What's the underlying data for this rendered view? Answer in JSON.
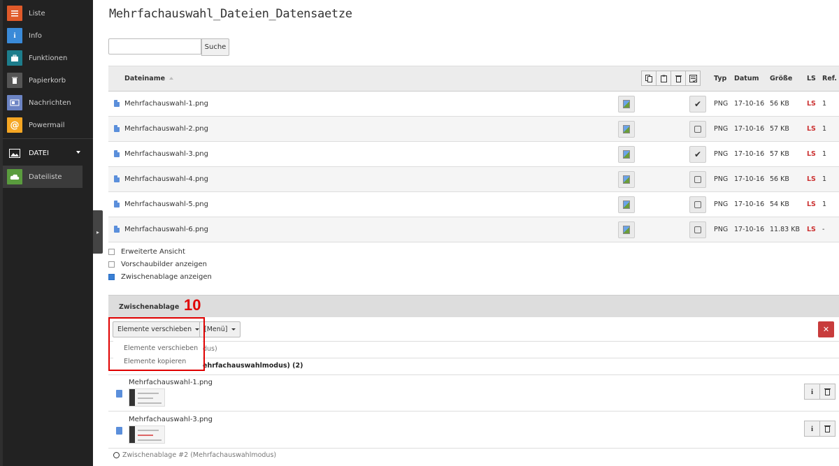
{
  "sidebar": {
    "modules": [
      {
        "label": "Liste",
        "icon": "list-icon",
        "color": "#e05a2a"
      },
      {
        "label": "Info",
        "icon": "info-icon",
        "color": "#3a8ad8"
      },
      {
        "label": "Funktionen",
        "icon": "toolbox-icon",
        "color": "#1d7d8c"
      },
      {
        "label": "Papierkorb",
        "icon": "trash-icon",
        "color": "#555555"
      },
      {
        "label": "Nachrichten",
        "icon": "message-icon",
        "color": "#6c84c4"
      },
      {
        "label": "Powermail",
        "icon": "powermail-icon",
        "color": "#f5a623"
      }
    ],
    "group": {
      "label": "DATEI",
      "icon": "image-icon"
    },
    "active": {
      "label": "Dateiliste",
      "icon": "filelist-icon",
      "color": "#5a9c3e"
    }
  },
  "page": {
    "title": "Mehrfachauswahl_Dateien_Datensaetze"
  },
  "search": {
    "button": "Suche",
    "value": ""
  },
  "table": {
    "headers": {
      "name": "Dateiname",
      "type": "Typ",
      "date": "Datum",
      "size": "Größe",
      "ls": "LS",
      "ref": "Ref."
    },
    "rows": [
      {
        "name": "Mehrfachauswahl-1.png",
        "checked": true,
        "type": "PNG",
        "date": "17-10-16",
        "size": "56 KB",
        "ls": "LS",
        "ref": "1"
      },
      {
        "name": "Mehrfachauswahl-2.png",
        "checked": false,
        "type": "PNG",
        "date": "17-10-16",
        "size": "57 KB",
        "ls": "LS",
        "ref": "1"
      },
      {
        "name": "Mehrfachauswahl-3.png",
        "checked": true,
        "type": "PNG",
        "date": "17-10-16",
        "size": "57 KB",
        "ls": "LS",
        "ref": "1"
      },
      {
        "name": "Mehrfachauswahl-4.png",
        "checked": false,
        "type": "PNG",
        "date": "17-10-16",
        "size": "56 KB",
        "ls": "LS",
        "ref": "1"
      },
      {
        "name": "Mehrfachauswahl-5.png",
        "checked": false,
        "type": "PNG",
        "date": "17-10-16",
        "size": "54 KB",
        "ls": "LS",
        "ref": "1"
      },
      {
        "name": "Mehrfachauswahl-6.png",
        "checked": false,
        "type": "PNG",
        "date": "17-10-16",
        "size": "11.83 KB",
        "ls": "LS",
        "ref": "-"
      }
    ]
  },
  "options": [
    {
      "label": "Erweiterte Ansicht",
      "checked": false
    },
    {
      "label": "Vorschaubilder anzeigen",
      "checked": false
    },
    {
      "label": "Zwischenablage anzeigen",
      "checked": true
    }
  ],
  "clipboard": {
    "title": "Zwischenablage",
    "annotation": "10",
    "move_button": "Elemente verschieben",
    "menu_button": "[Menü]",
    "dropdown": [
      "Elemente verschieben",
      "Elemente kopieren"
    ],
    "mode1_partial": "dus)",
    "mode2_partial": "ehrfachauswahlmodus) (2)",
    "items": [
      {
        "name": "Mehrfachauswahl-1.png"
      },
      {
        "name": "Mehrfachauswahl-3.png"
      }
    ],
    "mode_last": "Zwischenablage #2 (Mehrfachauswahlmodus)"
  }
}
